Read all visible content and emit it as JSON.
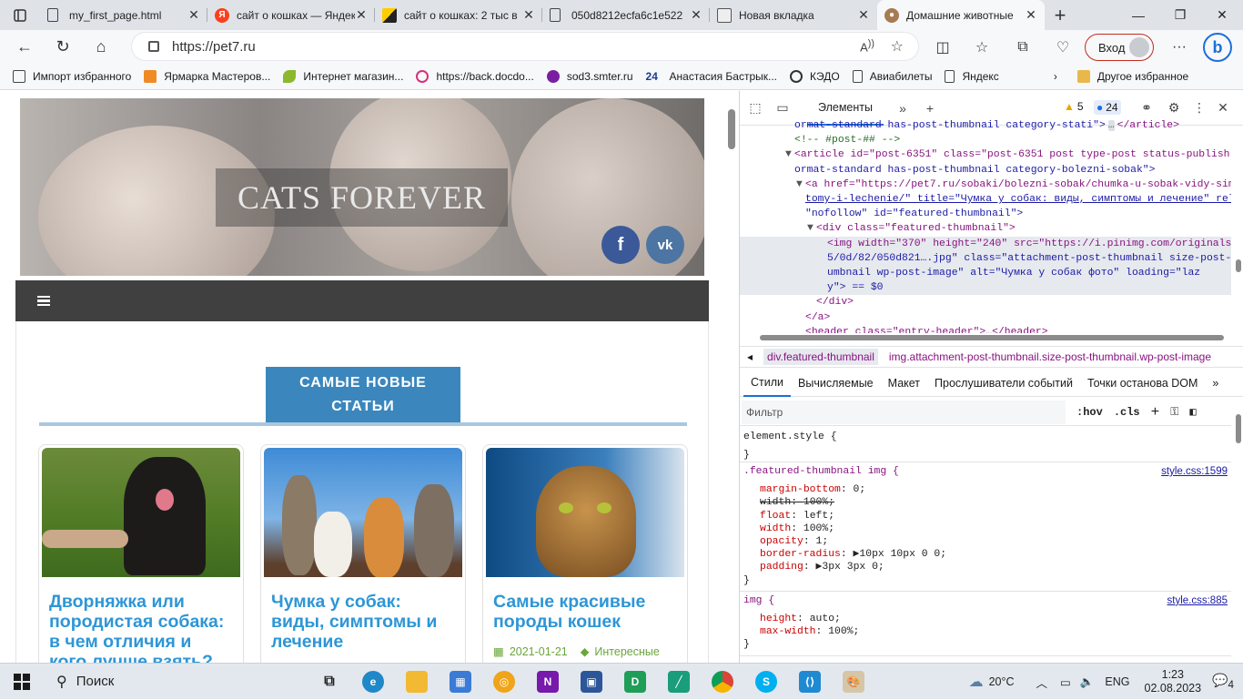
{
  "browser": {
    "tabs": [
      {
        "title": "my_first_page.html",
        "icon": "file-icon"
      },
      {
        "title": "сайт о кошках — Яндекс",
        "icon": "yandex-icon"
      },
      {
        "title": "сайт о кошках: 2 тыс в",
        "icon": "yandex-images-icon"
      },
      {
        "title": "050d8212ecfa6c1e522",
        "icon": "file-icon"
      },
      {
        "title": "Новая вкладка",
        "icon": "newtab-icon"
      },
      {
        "title": "Домашние животные",
        "icon": "pet-favicon-icon",
        "active": true
      }
    ],
    "url": "https://pet7.ru",
    "login_label": "Вход",
    "bookmarks": [
      "Импорт избранного",
      "Ярмарка Мастеров...",
      "Интернет магазин...",
      "https://back.docdo...",
      "sod3.smter.ru",
      "Анастасия Бастрык...",
      "КЭДО",
      "Авиабилеты",
      "Яндекс"
    ],
    "other_favorites": "Другое избранное"
  },
  "site": {
    "title": "CATS FOREVER",
    "section_heading_line1": "САМЫЕ НОВЫЕ",
    "section_heading_line2": "СТАТЬИ",
    "social": [
      "f",
      "vk"
    ],
    "cards": [
      {
        "title": "Дворняжка или породистая собака: в чем отличия и кого лучше взять?",
        "date": "",
        "category": ""
      },
      {
        "title": "Чумка у собак: виды, симптомы и лечение",
        "date": "",
        "category": ""
      },
      {
        "title": "Самые красивые породы кошек",
        "date": "2021-01-21",
        "category": "Интересные"
      }
    ]
  },
  "devtools": {
    "active_tab": "Элементы",
    "warnings": "5",
    "messages": "24",
    "dom_lines": [
      [
        "ormat-standard has-post-thumbnail category-stati\">",
        "</article>"
      ],
      "<!-- #post-## -->",
      "<article id=\"post-6351\" class=\"post-6351 post type-post status-publish f",
      "ormat-standard has-post-thumbnail category-bolezni-sobak\">",
      "<a href=\"https://pet7.ru/sobaki/bolezni-sobak/chumka-u-sobak-vidy-simp",
      "tomy-i-lechenie/\" title=\"Чумка у собак: виды, симптомы и лечение\" rel=",
      "\"nofollow\" id=\"featured-thumbnail\">",
      "<div class=\"featured-thumbnail\">",
      "<img width=\"370\" height=\"240\" src=\"https://i.pinimg.com/originals/0",
      "5/0d/82/050d821….jpg\" class=\"attachment-post-thumbnail size-post-th",
      "umbnail wp-post-image\" alt=\"Чумка у собак фото\" loading=\"laz",
      "y\"> == $0",
      "</div>",
      "</a>",
      "<header class=\"entry-header\">…</header>"
    ],
    "breadcrumbs": [
      "div.featured-thumbnail",
      "img.attachment-post-thumbnail.size-post-thumbnail.wp-post-image"
    ],
    "subtabs": [
      "Стили",
      "Вычисляемые",
      "Макет",
      "Прослушиватели событий",
      "Точки останова DOM"
    ],
    "filter_placeholder": "Фильтр",
    "hov": ":hov",
    "cls": ".cls",
    "rules": [
      {
        "selector": "element.style {",
        "source": "",
        "props": []
      },
      {
        "selector": ".featured-thumbnail img {",
        "source": "style.css:1599",
        "props": [
          [
            "margin-bottom",
            "0;",
            false
          ],
          [
            "width",
            "100%;",
            true
          ],
          [
            "float",
            "left;",
            false
          ],
          [
            "width",
            "100%;",
            false
          ],
          [
            "opacity",
            "1;",
            false
          ],
          [
            "border-radius",
            "▶10px 10px 0 0;",
            false
          ],
          [
            "padding",
            "▶3px 3px 0;",
            false
          ]
        ]
      },
      {
        "selector": "img {",
        "source": "style.css:885",
        "props": [
          [
            "height",
            "auto;",
            false
          ],
          [
            "max-width",
            "100%;",
            false
          ]
        ]
      }
    ]
  },
  "taskbar": {
    "search_label": "Поиск",
    "weather": "20°C",
    "lang": "ENG",
    "time": "1:23",
    "date": "02.08.2023",
    "notifications": "4"
  }
}
